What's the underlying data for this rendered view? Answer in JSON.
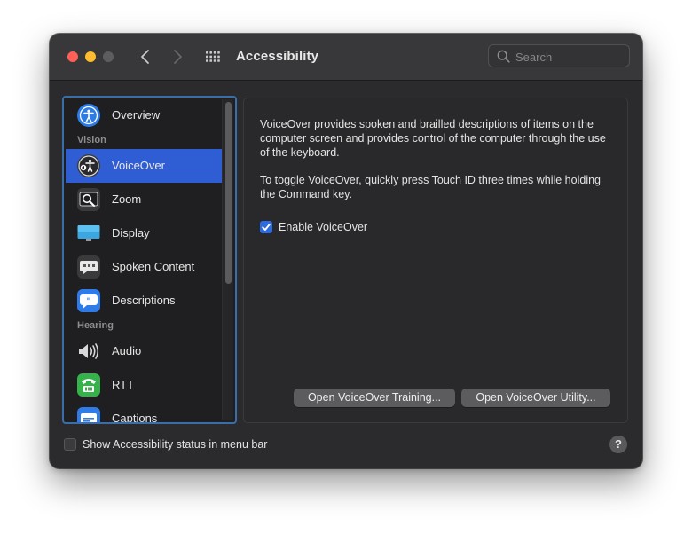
{
  "window": {
    "title": "Accessibility",
    "controls": [
      "close",
      "minimize",
      "zoom"
    ]
  },
  "search": {
    "placeholder": "Search",
    "value": ""
  },
  "sidebar": {
    "items": [
      {
        "label": "Overview",
        "icon": "accessibility-overview-icon"
      },
      {
        "header": "Vision"
      },
      {
        "label": "VoiceOver",
        "icon": "voiceover-icon",
        "selected": true
      },
      {
        "label": "Zoom",
        "icon": "zoom-magnifier-icon"
      },
      {
        "label": "Display",
        "icon": "display-monitor-icon"
      },
      {
        "label": "Spoken Content",
        "icon": "spoken-content-icon"
      },
      {
        "label": "Descriptions",
        "icon": "descriptions-quote-icon"
      },
      {
        "header": "Hearing"
      },
      {
        "label": "Audio",
        "icon": "speaker-icon"
      },
      {
        "label": "RTT",
        "icon": "rtt-phone-icon"
      },
      {
        "label": "Captions",
        "icon": "captions-icon"
      }
    ]
  },
  "content": {
    "description": "VoiceOver provides spoken and brailled descriptions of items on the computer screen and provides control of the computer through the use of the keyboard.",
    "toggle_hint": "To toggle VoiceOver, quickly press Touch ID three times while holding the Command key.",
    "enable_checkbox": {
      "label": "Enable VoiceOver",
      "checked": true
    },
    "buttons": {
      "training": "Open VoiceOver Training...",
      "utility": "Open VoiceOver Utility..."
    }
  },
  "footer": {
    "status_checkbox": {
      "label": "Show Accessibility status in menu bar",
      "checked": false
    },
    "help": "?"
  },
  "colors": {
    "window_bg": "#2b2b2d",
    "selection": "#2f5ed4",
    "checkbox_on": "#2d6ce0",
    "sidebar_focus_ring": "#3b6ea8"
  }
}
